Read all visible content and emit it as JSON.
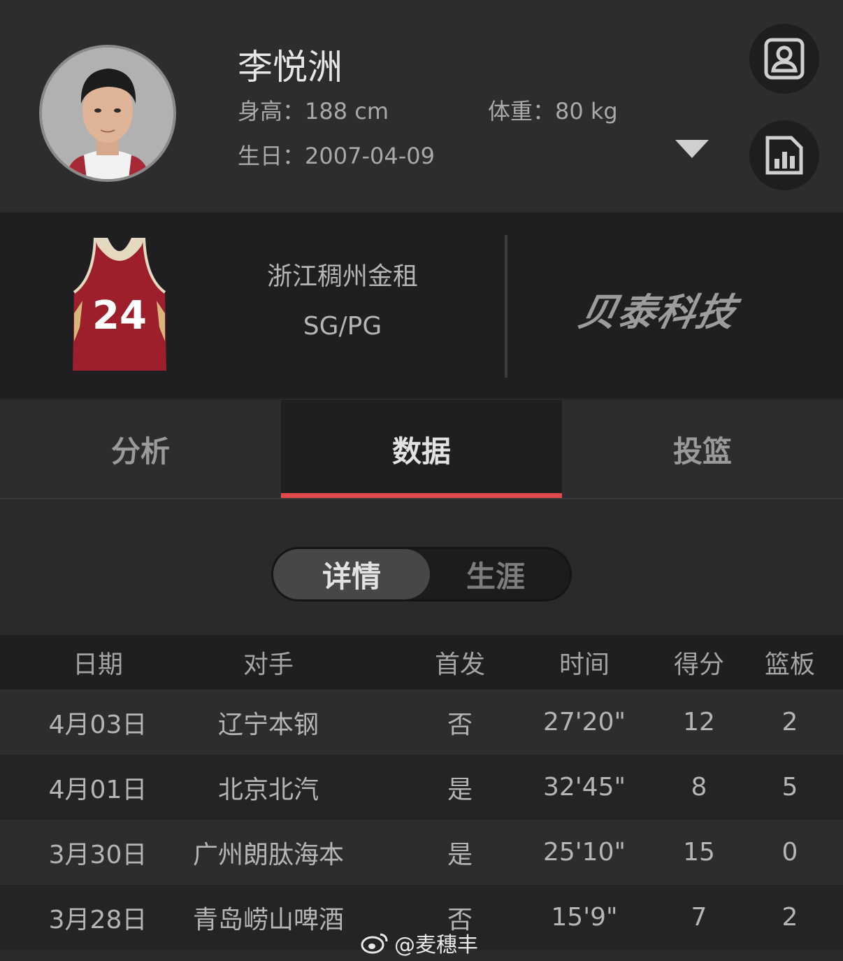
{
  "player": {
    "name": "李悦洲",
    "height": "身高：188 cm",
    "weight": "体重：80 kg",
    "birthday": "生日：2007-04-09"
  },
  "icons": {
    "profile": "profile-card-icon",
    "stats": "bar-chart-icon",
    "expand": "caret-down-icon"
  },
  "team": {
    "name": "浙江稠州金租",
    "position": "SG/PG",
    "jersey_number": "24",
    "sponsor": "贝泰科技"
  },
  "tabs": [
    {
      "label": "分析"
    },
    {
      "label": "数据"
    },
    {
      "label": "投篮"
    }
  ],
  "active_tab": "数据",
  "segment": {
    "options": [
      "详情",
      "生涯"
    ],
    "selected": "详情"
  },
  "table": {
    "headers": [
      "日期",
      "对手",
      "首发",
      "时间",
      "得分",
      "篮板"
    ],
    "rows": [
      [
        "4月03日",
        "辽宁本钢",
        "否",
        "27'20\"",
        "12",
        "2"
      ],
      [
        "4月01日",
        "北京北汽",
        "是",
        "32'45\"",
        "8",
        "5"
      ],
      [
        "3月30日",
        "广州朗肽海本",
        "是",
        "25'10\"",
        "15",
        "0"
      ],
      [
        "3月28日",
        "青岛崂山啤酒",
        "否",
        "15'9\"",
        "7",
        "2"
      ]
    ]
  },
  "watermark": "@麦穗丰",
  "colors": {
    "accent": "#e0484c",
    "jersey": "#9e1f2c",
    "background": "#2a2a2c"
  }
}
